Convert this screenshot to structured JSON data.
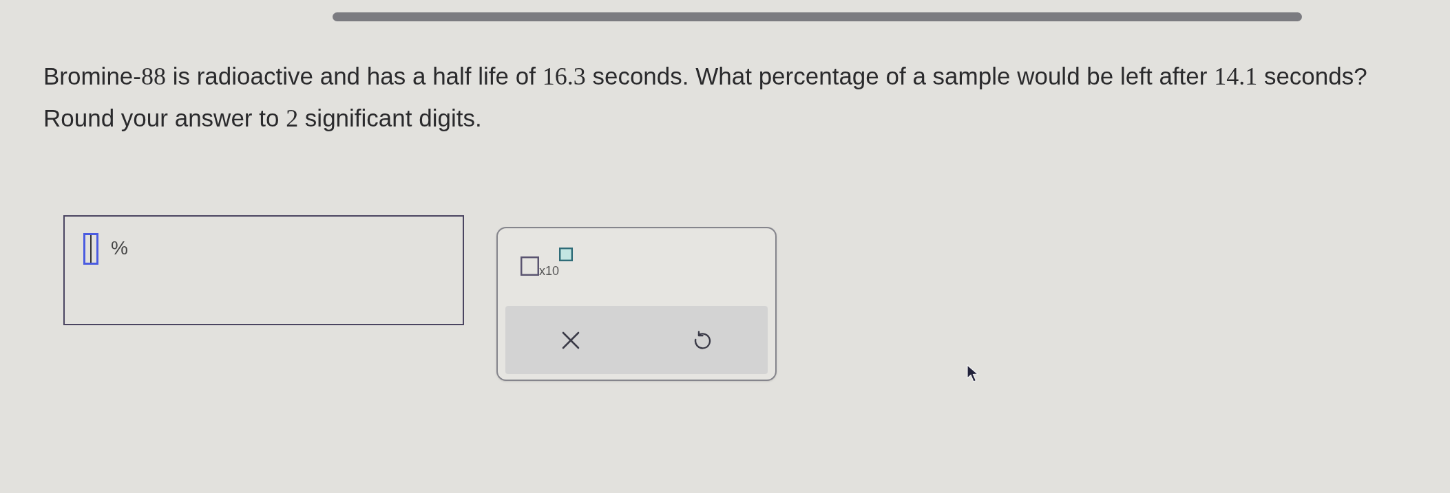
{
  "question": {
    "paragraphs": [
      [
        {
          "kind": "text",
          "text": "Bromine-"
        },
        {
          "kind": "math",
          "text": "88"
        },
        {
          "kind": "text",
          "text": " is radioactive and has a half life of "
        },
        {
          "kind": "math",
          "text": "16.3"
        },
        {
          "kind": "text",
          "text": " seconds. What percentage of a sample would be left after "
        },
        {
          "kind": "math",
          "text": "14.1"
        },
        {
          "kind": "text",
          "text": " seconds?"
        }
      ],
      [
        {
          "kind": "text",
          "text": "Round your answer to "
        },
        {
          "kind": "math",
          "text": "2"
        },
        {
          "kind": "text",
          "text": " significant digits."
        }
      ]
    ]
  },
  "answer": {
    "unit": "%"
  },
  "tools": {
    "template": {
      "label": "x10"
    },
    "buttons": [
      {
        "kind": "clear"
      },
      {
        "kind": "undo"
      }
    ]
  }
}
